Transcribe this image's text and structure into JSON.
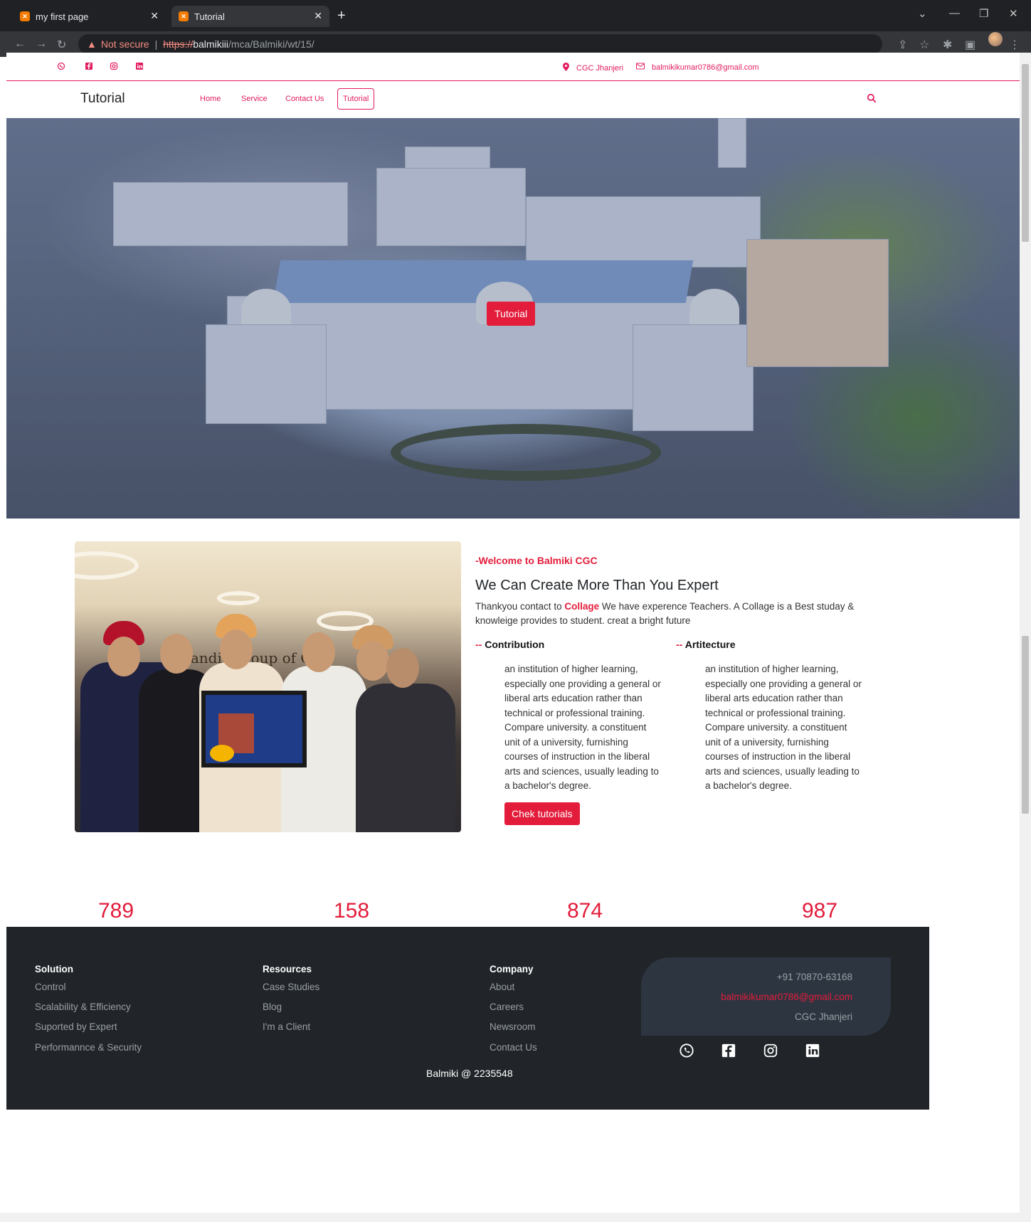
{
  "browser": {
    "tabs": [
      {
        "title": "my first page"
      },
      {
        "title": "Tutorial"
      }
    ],
    "address": {
      "warning": "Not secure",
      "scheme": "https://",
      "host": "balmikiii",
      "path": "/mca/Balmiki/wt/15/"
    }
  },
  "topbar": {
    "location": "CGC Jhanjeri",
    "email": "balmikikumar0786@gmail.com"
  },
  "navbar": {
    "brand": "Tutorial",
    "links": [
      {
        "label": "Home"
      },
      {
        "label": "Service"
      },
      {
        "label": "Contact Us"
      },
      {
        "label": "Tutorial"
      }
    ]
  },
  "hero": {
    "button_label": "Tutorial"
  },
  "about": {
    "eyebrow": "-Welcome to Balmiki CGC",
    "heading": "We Can Create More Than You Expert",
    "lead_prefix": "Thankyou contact to ",
    "lead_highlight": "Collage",
    "lead_suffix": " We have experence Teachers. A Collage is a Best studay & knowleige provides to student. creat a bright future",
    "columns": [
      {
        "dash": "-- ",
        "title": "Contribution",
        "text": "an institution of higher learning, especially one providing a general or liberal arts education rather than technical or professional training. Compare university. a constituent unit of a university, furnishing courses of instruction in the liberal arts and sciences, usually leading to a bachelor's degree."
      },
      {
        "dash": "-- ",
        "title": "Artitecture",
        "text": "an institution of higher learning, especially one providing a general or liberal arts education rather than technical or professional training. Compare university. a constituent unit of a university, furnishing courses of instruction in the liberal arts and sciences, usually leading to a bachelor's degree."
      }
    ],
    "cta_label": "Chek tutorials",
    "photo_wall_text": "handigar  oup of Col"
  },
  "stats": [
    "789",
    "158",
    "874",
    "987"
  ],
  "footer": {
    "columns": [
      {
        "title": "Solution",
        "links": [
          "Control",
          "Scalability & Efficiency",
          "Suported by Expert",
          "Performannce & Security"
        ]
      },
      {
        "title": "Resources",
        "links": [
          "Case Studies",
          "Blog",
          "I'm a Client"
        ]
      },
      {
        "title": "Company",
        "links": [
          "About",
          "Careers",
          "Newsroom",
          "Contact Us"
        ]
      }
    ],
    "contact": {
      "phone": "+91 70870-63168",
      "email": "balmikikumar0786@gmail.com",
      "location": "CGC Jhanjeri"
    },
    "copyright": "Balmiki @ 2235548"
  },
  "colors": {
    "accent": "#e31c3b",
    "footer_bg": "#212529"
  }
}
